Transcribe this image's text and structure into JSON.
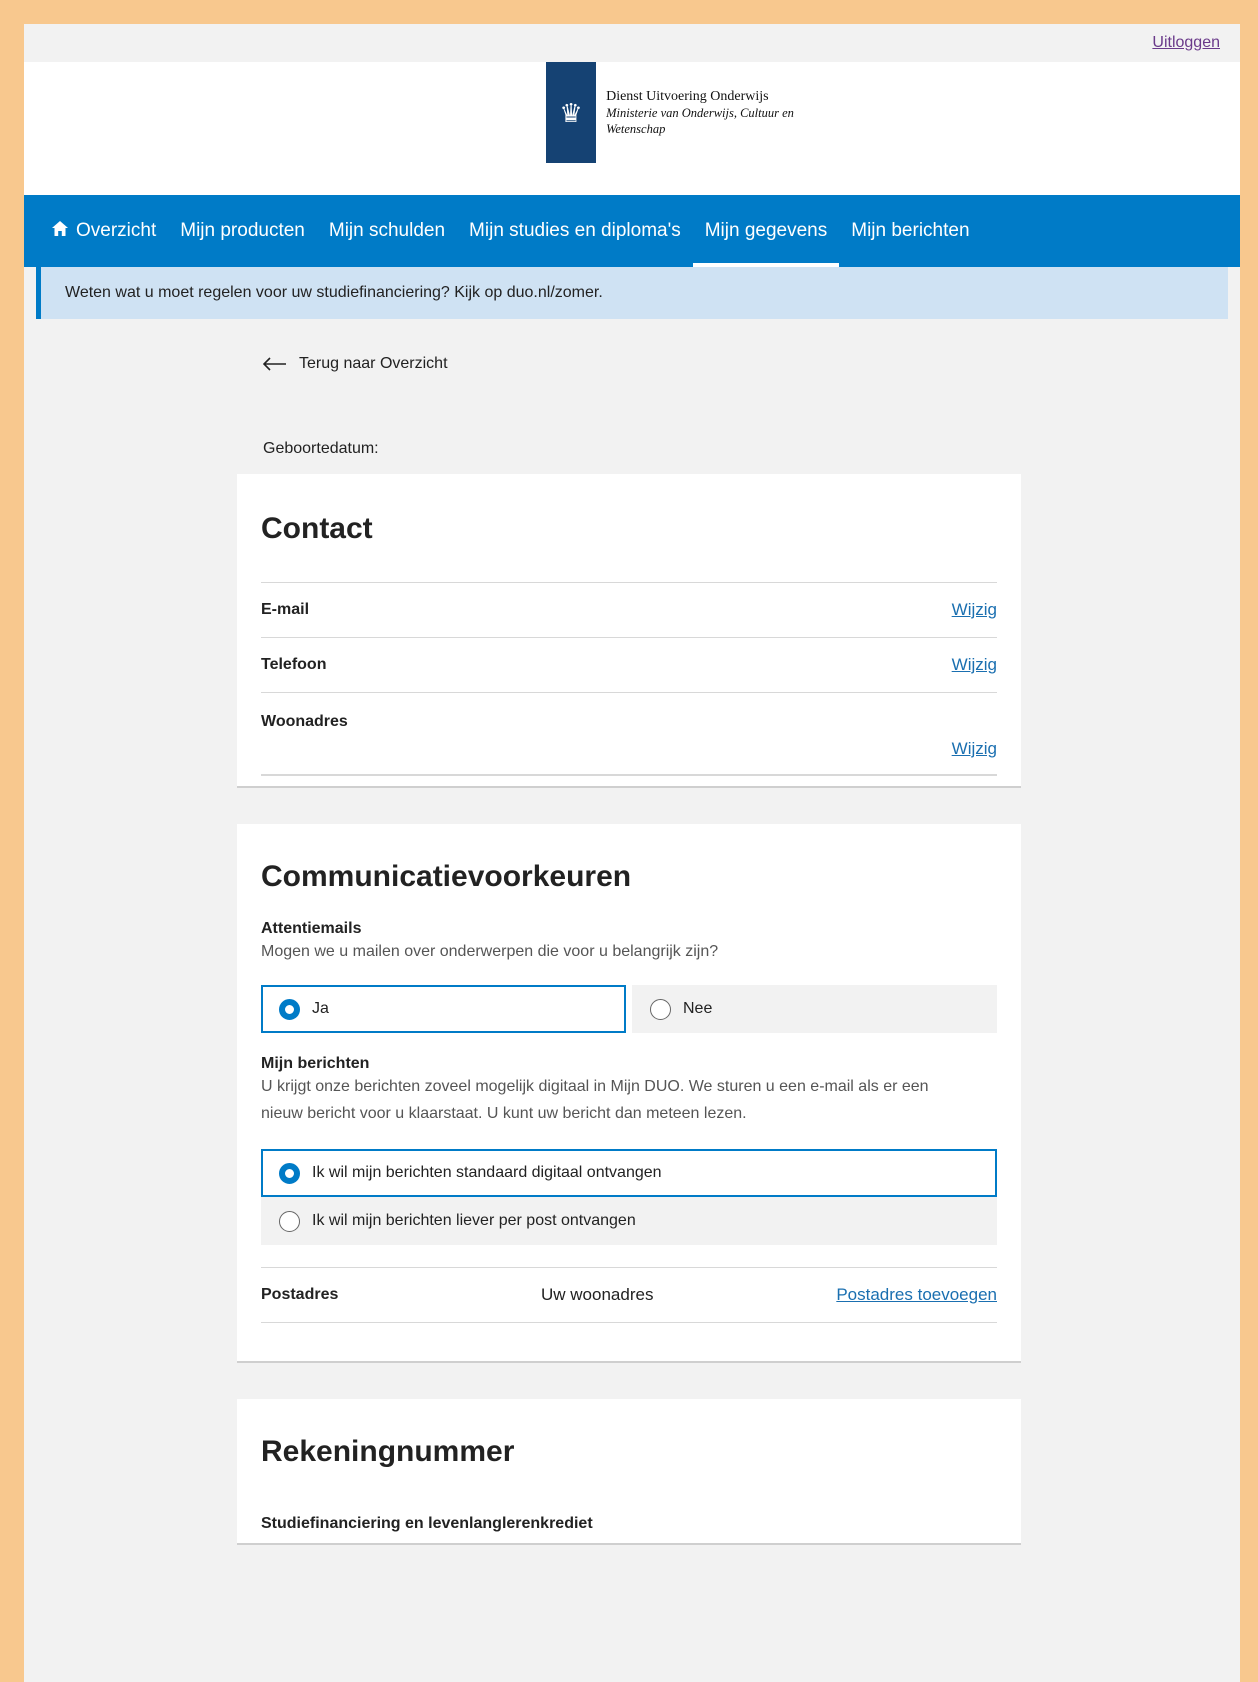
{
  "topbar": {
    "logout": "Uitloggen"
  },
  "logo": {
    "line1": "Dienst Uitvoering Onderwijs",
    "line2": "Ministerie van Onderwijs, Cultuur en",
    "line3": "Wetenschap"
  },
  "nav": {
    "items": [
      {
        "label": "Overzicht",
        "icon": "home-icon"
      },
      {
        "label": "Mijn producten"
      },
      {
        "label": "Mijn schulden"
      },
      {
        "label": "Mijn studies en diploma's"
      },
      {
        "label": "Mijn gegevens",
        "active": true
      },
      {
        "label": "Mijn berichten"
      }
    ]
  },
  "notice": {
    "text": "Weten wat u moet regelen voor uw studiefinanciering? Kijk op duo.nl/zomer."
  },
  "back": {
    "label": "Terug naar Overzicht"
  },
  "dob": {
    "label": "Geboortedatum:"
  },
  "contact": {
    "title": "Contact",
    "rows": [
      {
        "label": "E-mail",
        "action": "Wijzig"
      },
      {
        "label": "Telefoon",
        "action": "Wijzig"
      },
      {
        "label": "Woonadres",
        "action": "Wijzig"
      }
    ]
  },
  "comm": {
    "title": "Communicatievoorkeuren",
    "attention_title": "Attentiemails",
    "attention_text": "Mogen we u mailen over onderwerpen die voor u belangrijk zijn?",
    "attention_options": [
      {
        "label": "Ja",
        "selected": true
      },
      {
        "label": "Nee",
        "selected": false
      }
    ],
    "messages_title": "Mijn berichten",
    "messages_text_1": "U krijgt onze berichten zoveel mogelijk digitaal in Mijn DUO. We sturen u een e-mail als er een",
    "messages_text_2": "nieuw bericht voor u klaarstaat. U kunt uw bericht dan meteen lezen.",
    "messages_options": [
      {
        "label": "Ik wil mijn berichten standaard digitaal ontvangen",
        "selected": true
      },
      {
        "label": "Ik wil mijn berichten liever per post ontvangen",
        "selected": false
      }
    ],
    "postadres_label": "Postadres",
    "postadres_value": "Uw woonadres",
    "postadres_action": "Postadres toevoegen"
  },
  "account": {
    "title": "Rekeningnummer",
    "subtitle": "Studiefinanciering en levenlanglerenkrediet"
  },
  "colors": {
    "nav": "#007bc7",
    "notice": "#cfe2f3",
    "logo_ribbon": "#154273",
    "frame": "#f8c88e"
  }
}
